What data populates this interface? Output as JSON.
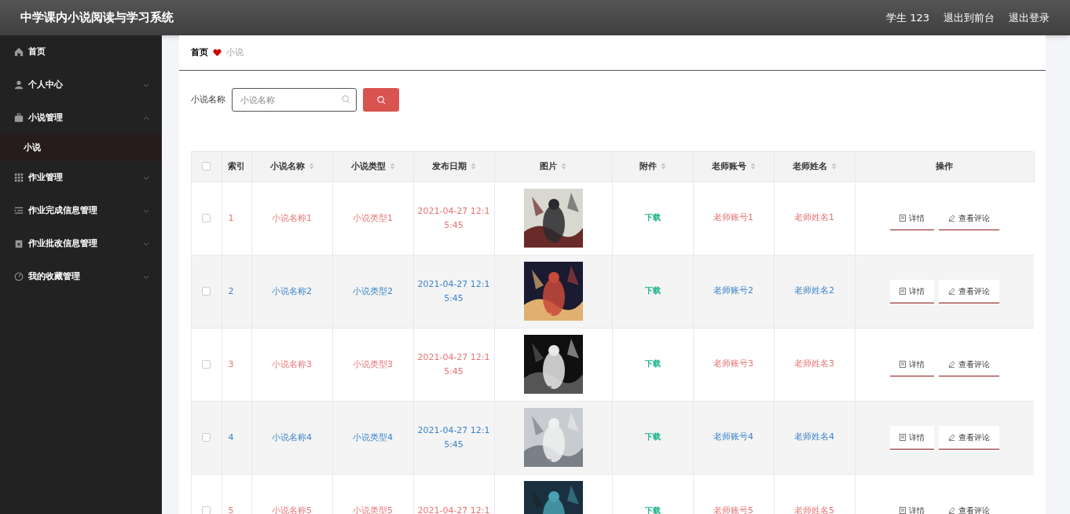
{
  "header": {
    "title": "中学课内小说阅读与学习系统",
    "links": [
      "学生 123",
      "退出到前台",
      "退出登录"
    ]
  },
  "sidebar": {
    "items": [
      {
        "label": "首页"
      },
      {
        "label": "个人中心",
        "expanded": false
      },
      {
        "label": "小说管理",
        "expanded": true,
        "children": [
          {
            "label": "小说",
            "selected": true
          }
        ]
      },
      {
        "label": "作业管理",
        "expanded": false
      },
      {
        "label": "作业完成信息管理",
        "expanded": false
      },
      {
        "label": "作业批改信息管理",
        "expanded": false
      },
      {
        "label": "我的收藏管理",
        "expanded": false
      }
    ]
  },
  "breadcrumb": [
    "首页",
    "小说"
  ],
  "search": {
    "label": "小说名称",
    "placeholder": "小说名称"
  },
  "table": {
    "select_all_checked": false,
    "columns": [
      {
        "label": "索引",
        "sortable": false
      },
      {
        "label": "小说名称",
        "sortable": true
      },
      {
        "label": "小说类型",
        "sortable": true
      },
      {
        "label": "发布日期",
        "sortable": true
      },
      {
        "label": "图片",
        "sortable": true
      },
      {
        "label": "附件",
        "sortable": true
      },
      {
        "label": "老师账号",
        "sortable": true
      },
      {
        "label": "老师姓名",
        "sortable": true
      },
      {
        "label": "操作",
        "sortable": false
      }
    ],
    "rows": [
      {
        "checked": false,
        "color": "#e57373",
        "index": "1",
        "name": "小说名称1",
        "type": "小说类型1",
        "date": "2021-04-27 12:15:45",
        "image": {
          "kind": "picture"
        },
        "attachment": "下载",
        "teacher_account": "老师账号1",
        "teacher_name": "老师姓名1",
        "actions": [
          "详情",
          "查看评论"
        ]
      },
      {
        "checked": false,
        "color": "#3a83c8",
        "index": "2",
        "name": "小说名称2",
        "type": "小说类型2",
        "date": "2021-04-27 12:15:45",
        "image": {
          "kind": "picture"
        },
        "attachment": "下载",
        "teacher_account": "老师账号2",
        "teacher_name": "老师姓名2",
        "actions": [
          "详情",
          "查看评论"
        ]
      },
      {
        "checked": false,
        "color": "#e57373",
        "index": "3",
        "name": "小说名称3",
        "type": "小说类型3",
        "date": "2021-04-27 12:15:45",
        "image": {
          "kind": "picture"
        },
        "attachment": "下载",
        "teacher_account": "老师账号3",
        "teacher_name": "老师姓名3",
        "actions": [
          "详情",
          "查看评论"
        ]
      },
      {
        "checked": false,
        "color": "#3a83c8",
        "index": "4",
        "name": "小说名称4",
        "type": "小说类型4",
        "date": "2021-04-27 12:15:45",
        "image": {
          "kind": "picture"
        },
        "attachment": "下载",
        "teacher_account": "老师账号4",
        "teacher_name": "老师姓名4",
        "actions": [
          "详情",
          "查看评论"
        ]
      },
      {
        "checked": false,
        "color": "#e57373",
        "index": "5",
        "name": "小说名称5",
        "type": "小说类型5",
        "date": "2021-04-27 12:1",
        "image": {
          "kind": "picture"
        },
        "attachment": "下载",
        "teacher_account": "老师账号5",
        "teacher_name": "老师姓名5",
        "actions": [
          "详情",
          "查看评论"
        ]
      }
    ]
  }
}
